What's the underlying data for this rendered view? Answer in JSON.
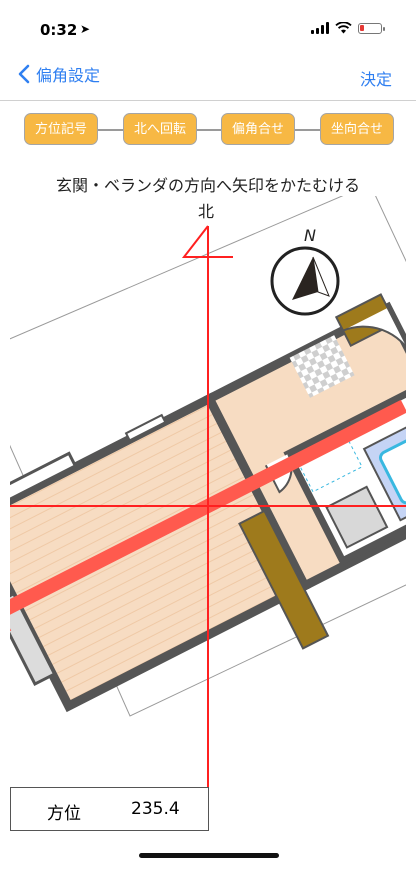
{
  "status": {
    "time": "0:32"
  },
  "nav": {
    "back_label": "偏角設定",
    "done_label": "決定"
  },
  "steps": [
    "方位記号",
    "北へ回転",
    "偏角合せ",
    "坐向合せ"
  ],
  "instruction": "玄関・ベランダの方向へ矢印をかたむける",
  "compass": {
    "north_label": "北",
    "n_label": "N"
  },
  "azimuth": {
    "label": "方位",
    "value": "235.4"
  },
  "colors": {
    "accent": "#2f7ff1",
    "step": "#f7b844",
    "red_line": "#ff2020",
    "arrow": "#ff5a4e",
    "floor": "#f7dcc2",
    "wall": "#555555"
  }
}
